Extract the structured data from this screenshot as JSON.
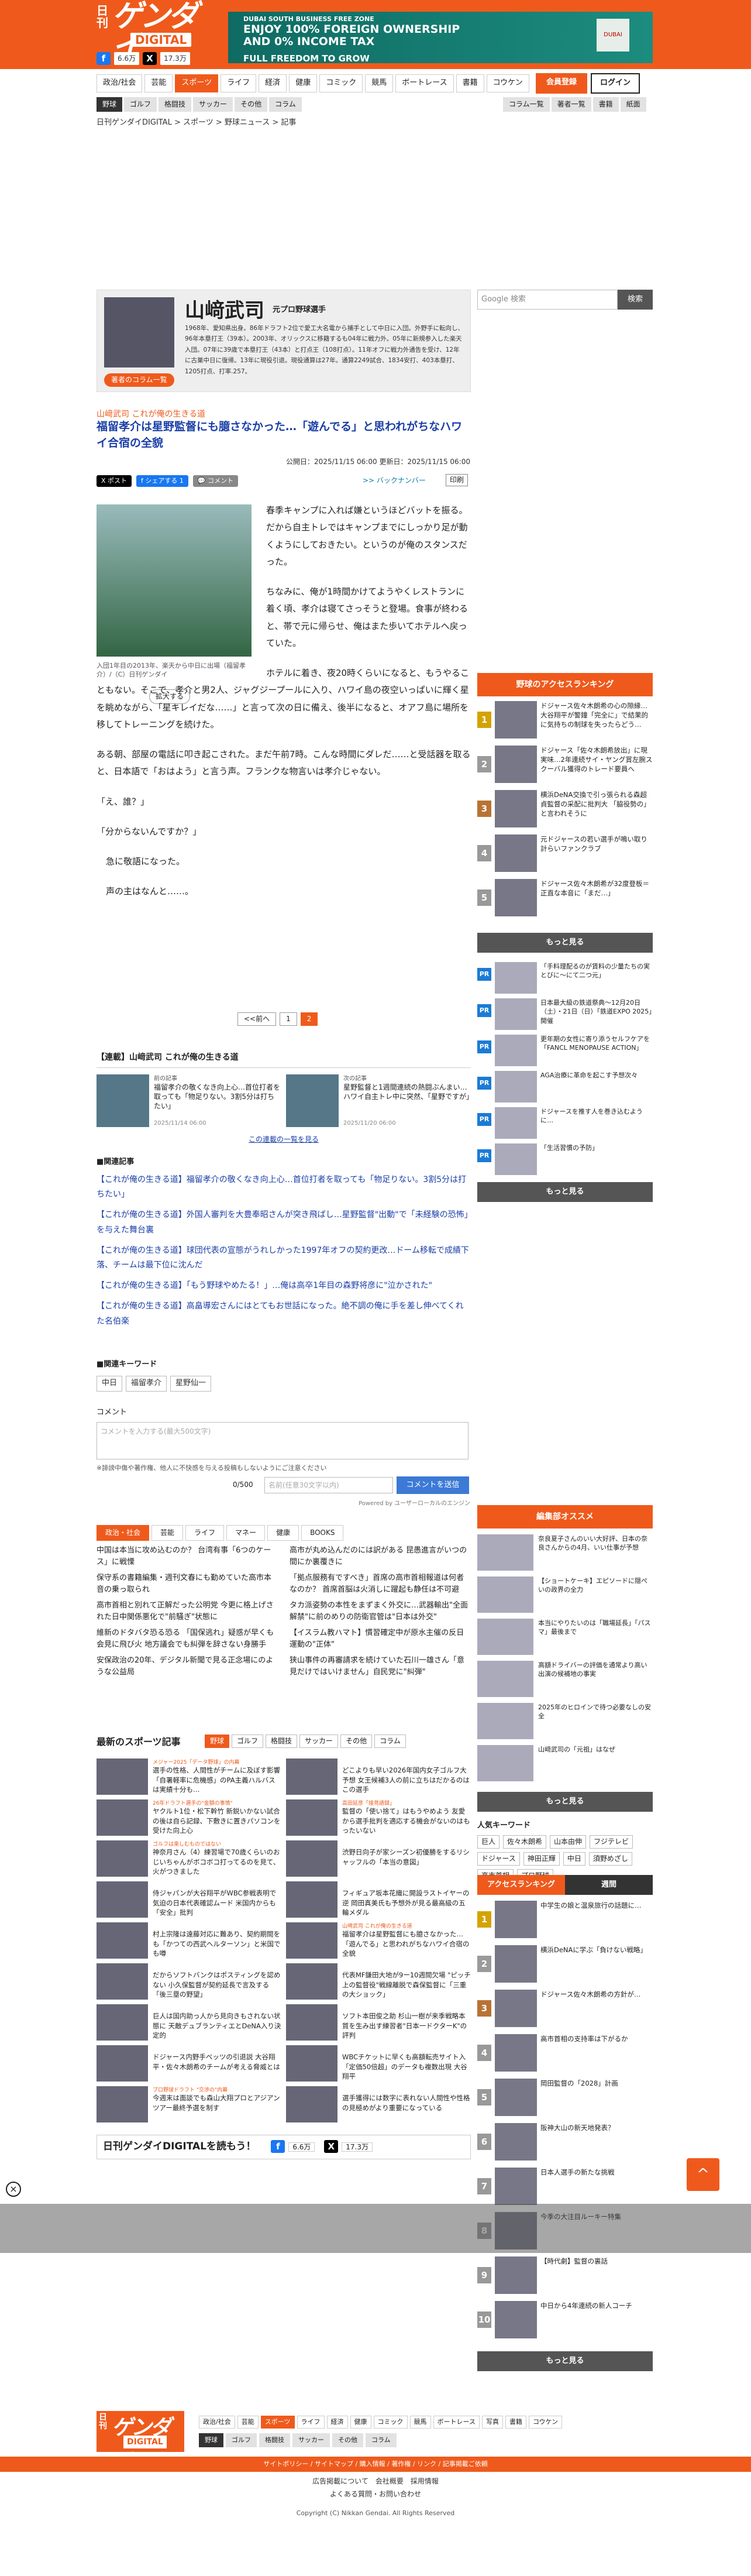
{
  "header": {
    "logo_nikkan": "日刊",
    "logo_gendai": "ゲンダイ",
    "logo_digital": "DIGITAL",
    "fb_count": "6.6万",
    "x_count": "17.3万",
    "banner": {
      "line1": "DUBAI SOUTH BUSINESS FREE ZONE",
      "line2": "ENJOY 100% FOREIGN OWNERSHIP AND 0% INCOME TAX",
      "line3": "FULL FREEDOM TO GROW",
      "logo": "DUBAI SOUTH"
    }
  },
  "nav": {
    "items": [
      "政治/社会",
      "芸能",
      "スポーツ",
      "ライフ",
      "経済",
      "健康",
      "コミック",
      "競馬",
      "ボートレース",
      "書籍",
      "コウケン"
    ],
    "member": "会員登録",
    "login": "ログイン",
    "sub": [
      "野球",
      "ゴルフ",
      "格闘技",
      "サッカー",
      "その他",
      "コラム"
    ],
    "sub_right": [
      "コラム一覧",
      "著者一覧",
      "書籍",
      "紙面"
    ]
  },
  "breadcrumb": "日刊ゲンダイDIGITAL > スポーツ > 野球ニュース > 記事",
  "author": {
    "name": "山﨑武司",
    "role": "元プロ野球選手",
    "bio": "1968年、愛知県出身。86年ドラフト2位で愛工大名電から捕手として中日に入団。外野手に転向し、96年本塁打王（39本）。2003年、オリックスに移籍するも04年に戦力外。05年に新規参入した楽天入団。07年に39歳で本塁打王（43本）と打点王（108打点）。11年オフに戦力外通告を受け、12年に古巣中日に復帰。13年に現役引退。現役通算は27年。通算2249試合、1834安打、403本塁打、1205打点、打率.257。",
    "more": "著者のコラム一覧"
  },
  "article": {
    "series": "山﨑武司 これが俺の生きる道",
    "title": "福留孝介は星野監督にも臆さなかった…「遊んでる」と思われがちなハワイ合宿の全貌",
    "published": "公開日：2025/11/15 06:00",
    "updated": "更新日：2025/11/15 06:00",
    "backnumber": ">> バックナンバー",
    "print": "印刷",
    "caption": "入団1年目の2013年、楽天から中日に出場（福留孝介）/（C）日刊ゲンダイ",
    "enlarge": "拡大する",
    "paragraphs": [
      "春季キャンプに入れば嫌というほどバットを振る。だから自主トレではキャンプまでにしっかり足が動くようにしておきたい。というのが俺のスタンスだった。",
      "ちなみに、俺が1時間かけてようやくレストランに着く頃、孝介は寝てさっそうと登場。食事が終わると、帯で元に帰らせ、俺はまた歩いてホテルへ戻っていた。",
      "ホテルに着き、夜20時くらいになると、もうやることもない。そこで、孝介と男2人、ジャグジープールに入り、ハワイ島の夜空いっぱいに輝く星を眺めながら、「星キレイだな……」と言って次の日に備え、後半になると、オアフ島に場所を移してトレーニングを続けた。",
      "ある朝、部屋の電話に叩き起こされた。まだ午前7時。こんな時間にダレだ……と受話器を取ると、日本語で「おはよう」と言う声。フランクな物言いは孝介じゃない。",
      "「え、誰？」",
      "「分からないんですか？」",
      "急に敬語になった。",
      "声の主はなんと……。"
    ],
    "pagination": [
      "<<前へ",
      "1",
      "2"
    ]
  },
  "series_box": {
    "heading": "【連載】山﨑武司 これが俺の生きる道",
    "items": [
      {
        "label": "前の記事",
        "text": "福留孝介の敬くなき向上心…首位打者を取っても「物足りない。3割5分は打ちたい」",
        "date": "2025/11/14 06:00"
      },
      {
        "label": "次の記事",
        "text": "星野監督と1週間連続の熱闘ぶんまい…ハワイ自主トレ中に突然、「星野ですが」",
        "date": "2025/11/20 06:00"
      }
    ],
    "all": "この連載の一覧を見る"
  },
  "related": {
    "heading": "■関連記事",
    "items": [
      "【これが俺の生きる道】福留孝介の敬くなき向上心…首位打者を取っても「物足りない。3割5分は打ちたい」",
      "【これが俺の生きる道】外国人審判を大豊奉昭さんが突き飛ばし…星野監督\"出動\"で「未経験の恐怖」を与えた舞台裏",
      "【これが俺の生きる道】球団代表の宣態がうれしかった1997年オフの契約更改…ドーム移転で成績下落、チームは最下位に沈んだ",
      "【これが俺の生きる道】「もう野球やめたる！」…俺は高卒1年目の森野将彦に\"泣かされた\"",
      "【これが俺の生きる道】高畠導宏さんにはとてもお世話になった。絶不調の俺に手を差し伸べてくれた名伯楽"
    ],
    "kw_heading": "■関連キーワード",
    "keywords": [
      "中日",
      "福留孝介",
      "星野仙一"
    ]
  },
  "comment": {
    "heading": "コメント",
    "placeholder": "コメントを入力する(最大500文字)",
    "note": "※誹謗中傷や著作権、他人に不快感を与える投稿もしないようにご注意ください",
    "count": "0/500",
    "name_placeholder": "名前(任意30文字以内)",
    "submit": "コメントを送信",
    "powered": "Powered by ユーザーローカルのエンジン"
  },
  "cat_tabs": [
    "政治・社会",
    "芸能",
    "ライフ",
    "マネー",
    "健康",
    "BOOKS"
  ],
  "cat_items": [
    "中国は本当に攻め込むのか？ 台湾有事「6つのケース」に戦慄",
    "高市が丸め込んだのには訳がある 昆愚進言がいつの間にか裏覆きに",
    "保守系の書籍編集・週刊文春にも勤めていた高市本音の乗っ取られ",
    "「拠点服務有ですべき」首席の高市首相報道は何者なのか？ 首席首脳は火消しに躍起も静任は不可避",
    "高市首相と別れて正解だった公明党 今更に格上げされた日中関係悪化で\"前騒ぎ\"状態に",
    "タカ派姿勢の本性をまずまく外交に…武器輸出\"全面解禁\"に前のめりの防衛官管は\"日本は外交\"",
    "維新のドタバタ恐る恐る 「国保逃れ」疑惑が早くも会見に飛び火 地方議会でも糾弾を辞さない身勝手",
    "【イスラム教ハマト】慣習確定中が原水主催の反日運動の\"正体\"",
    "安保政治の20年、デジタル新聞で見る正念場にのような公益局",
    "狭山事件の再審請求を続けていた石川一雄さん「意見だけではいけません」自民党に\"糾弾\""
  ],
  "latest": {
    "heading": "最新のスポーツ記事",
    "tabs": [
      "野球",
      "ゴルフ",
      "格闘技",
      "サッカー",
      "その他",
      "コラム"
    ],
    "items": [
      {
        "tag": "メジャー2025「データ野球」の内幕",
        "text": "選手の性格、人間性がチームに及ぼす影響「自署軽率に危機感」のPA主義ハルバスは実績十分も…"
      },
      {
        "tag": "",
        "text": "どこよりも早い2026年国内女子ゴルフ大予想 女王候補3人の前に立ちはだかるのはこの選手"
      },
      {
        "tag": "26年ドラフト選手の\"金額の事情\"",
        "text": "ヤクルト1位・松下幹竹 新鋭いかない試合の後は自ら記録、下敷きに置きパソコンを受けた向上心"
      },
      {
        "tag": "高田延彦「接見語録」",
        "text": "監督の「使い捨て」はもうやめよう 友愛から選手批判を適応する機会がないのはもったいない"
      },
      {
        "tag": "ゴルフは楽しむものではない",
        "text": "神奈月さん（4）練習場で70歳くらいのおじいちゃんがボコボコ打ってるのを見て、火がつきました"
      },
      {
        "tag": "",
        "text": "渋野日向子が家シーズン初優勝をするリシャッフルの「本当の意図」"
      },
      {
        "tag": "",
        "text": "侍ジャパンが大谷翔平がWBC参戦表明で気迫の日本代表確認ムード 米国内からも「安全」批判"
      },
      {
        "tag": "",
        "text": "フィギュア坂本花織に開設ラストイヤーの逆 岡田真美氏も予想外が見る最高級の五輪メダル"
      },
      {
        "tag": "",
        "text": "村上宗隆は遠藤対応に難あり、契約期間をも「かつての西武ヘルターソン」と米国でも噂"
      },
      {
        "tag": "山﨑武司 これが俺の生きる道",
        "text": "福留孝介は星野監督にも臆さなかった…「遊んでる」と思われがちなハワイ合宿の全貌"
      },
      {
        "tag": "",
        "text": "だからソフトバンクはポスティングを認めない 小久保監督が契約延長で言及する「後三塁の野望」"
      },
      {
        "tag": "",
        "text": "代表MF鎌田大地が9ー10週間欠場 \"ピッチ上の監督役\"戦線離脱で森保監督に「三重の大ショック」"
      },
      {
        "tag": "",
        "text": "巨人は国内助っ人から見向きもされない状態に 天敵デュブランティエとDeNA入り決定的"
      },
      {
        "tag": "",
        "text": "ソフト本田俊之助 杉山一樹が来季戦略本質を生み出す練習者\"日本一ドクターK\"の評判"
      },
      {
        "tag": "",
        "text": "ドジャース内野手ベッツの引退説 大谷翔平・佐々木朗希のチームが考える脅威とは"
      },
      {
        "tag": "",
        "text": "WBCチケットに早くも高額転売サイト入 「定価50倍超」のデータも複数出現 大谷翔平"
      },
      {
        "tag": "プロ野球ドラフト \"交渉の\"内幕",
        "text": "今週末は面談でも森山大翔プロとアジアンツアー最終予選を制す"
      },
      {
        "tag": "",
        "text": "選手獲得には数字に表れない人間性や性格の見極めがより重要になっている"
      }
    ],
    "share_text": "日刊ゲンダイDIGITALを読もう！",
    "share_fb": "6.6万",
    "share_x": "17.3万"
  },
  "sidebar": {
    "search_placeholder": "Google 検索",
    "search_btn": "検索",
    "rank_head": "野球のアクセスランキング",
    "rank": [
      "ドジャース佐々木朗希の心の隙縁…大谷翔平が警鐘「完全に」で結果的に気持ちの制球を失ったらどう…",
      "ドジャース「佐々木朗希放出」に現実味…2年連続サイ・ヤング賞左腕スクーバル獲得のトレード要員へ",
      "横浜DeNA交換で引っ張られる森超貞監督の采配に批判大 「脇役勢の」と言われそうに",
      "元ドジャースの若い選手が鳴い取り計らいファンクラブ",
      "ドジャース佐々木朗希が32度登板＝正直な本音に「まだ…」"
    ],
    "more": "もっと見る",
    "pr": [
      "「手料理配るのが賃料の少量たちの実とびに〜にて二つ元」",
      "日本最大級の鉄道祭典〜12月20日（土）・21日（日）「鉄道EXPO 2025」開催",
      "更年期の女性に寄り添うセルフケアを「FANCL MENOPAUSE ACTION」",
      "AGA治療に革命を起こす予想次々",
      "ドジャースを推す人を巻き込むように…",
      "「生活習慣の予防」"
    ],
    "editor_head": "編集部オススメ",
    "editor": [
      "奈良夏子さんのいい大好評、日本の奈良さんからの4月、いい仕事が予想",
      "【ショートケーキ】エピソードに隠ぺいの政界の全力",
      "本当にやりたいのは「職場延長」「パスマ」最後まで",
      "高額ドライバーの評価を通常より高い出演の候補地の事実",
      "2025年のヒロインで待つ必要なしの安全",
      "山﨑武司の「元祖」はなぜ"
    ],
    "kw_head": "人気キーワード",
    "keywords": [
      "巨人",
      "佐々木朗希",
      "山本由伸",
      "フジテレビ",
      "ドジャース",
      "神田正輝",
      "中日",
      "須野めざし",
      "高市首相",
      "プロ野球"
    ],
    "rank_tabs": [
      "アクセスランキング",
      "週間"
    ],
    "rank2": [
      "中学生の娘と温泉旅行の話題に…",
      "横浜DeNAに学ぶ「負けない戦略」",
      "ドジャース佐々木朗希の方針が…",
      "高市首相の支持率は下がるか",
      "岡田監督の「2028」計画",
      "阪神大山の新天地発表？",
      "日本人選手の新たな挑戦",
      "今季の大注目ルーキー特集",
      "【時代劇】監督の裏話",
      "中日から4年連続の新人コーチ"
    ]
  },
  "bottom": {
    "nav": [
      "政治/社会",
      "芸能",
      "スポーツ",
      "ライフ",
      "経済",
      "健康",
      "コミック",
      "競馬",
      "ボートレース",
      "写真",
      "書籍",
      "コウケン"
    ],
    "sub": [
      "野球",
      "ゴルフ",
      "格闘技",
      "サッカー",
      "その他",
      "コラム"
    ],
    "footer_bar": "サイトポリシー / サイトマップ / 購入情報 / 著作権 / リンク / 記事掲載ご依頼",
    "links1": "広告掲載について　会社概要　採用情報",
    "links2": "よくある質問・お問い合わせ",
    "copy": "Copyright (C) Nikkan Gendai. All Rights Reserved"
  }
}
